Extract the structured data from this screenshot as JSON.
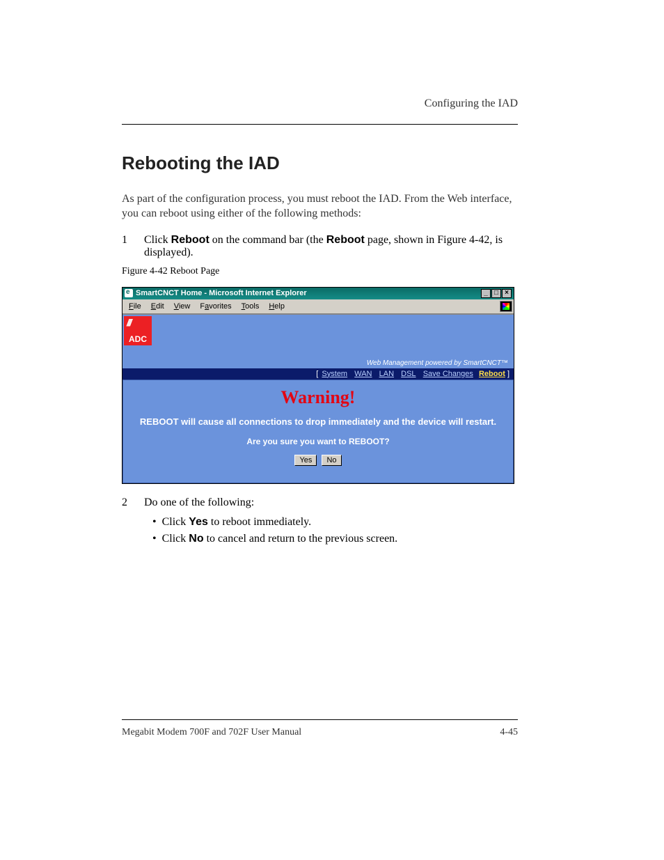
{
  "header": {
    "running": "Configuring the IAD"
  },
  "section": {
    "title": "Rebooting the IAD"
  },
  "paragraph1": "As part of the configuration process, you must reboot the IAD. From the Web interface, you can reboot using either of the following methods:",
  "step1_prefix": "Click ",
  "step1_word1": "Reboot",
  "step1_mid": " on the command bar (the ",
  "step1_word2": "Reboot",
  "step1_suffix": " page, shown in Figure 4-42, is displayed).",
  "figcaption": "Figure 4-42 Reboot Page",
  "window": {
    "title": "SmartCNCT Home - Microsoft Internet Explorer",
    "menus": {
      "file": "File",
      "edit": "Edit",
      "view": "View",
      "favorites": "Favorites",
      "tools": "Tools",
      "help": "Help"
    },
    "adc": "ADC",
    "tagline": "Web Management powered by SmartCNCT™",
    "nav": {
      "open": "[ ",
      "system": "System",
      "wan": "WAN",
      "lan": "LAN",
      "dsl": "DSL",
      "save": "Save Changes",
      "reboot": "Reboot",
      "close": " ]"
    },
    "warning_title": "Warning!",
    "warning_body": "REBOOT will cause all connections to drop immediately and the device will restart.",
    "warning_q": "Are you sure you want to REBOOT?",
    "yes": "Yes",
    "no": "No"
  },
  "step2_pre": "Do one of the following:",
  "bullet1_pre": "Click ",
  "bullet1_word": "Yes",
  "bullet1_post": " to reboot immediately.",
  "bullet2_pre": "Click ",
  "bullet2_word": "No",
  "bullet2_post": " to cancel and return to the previous screen.",
  "footer": {
    "left": "Megabit Modem 700F and 702F User Manual",
    "right": "4-45"
  }
}
